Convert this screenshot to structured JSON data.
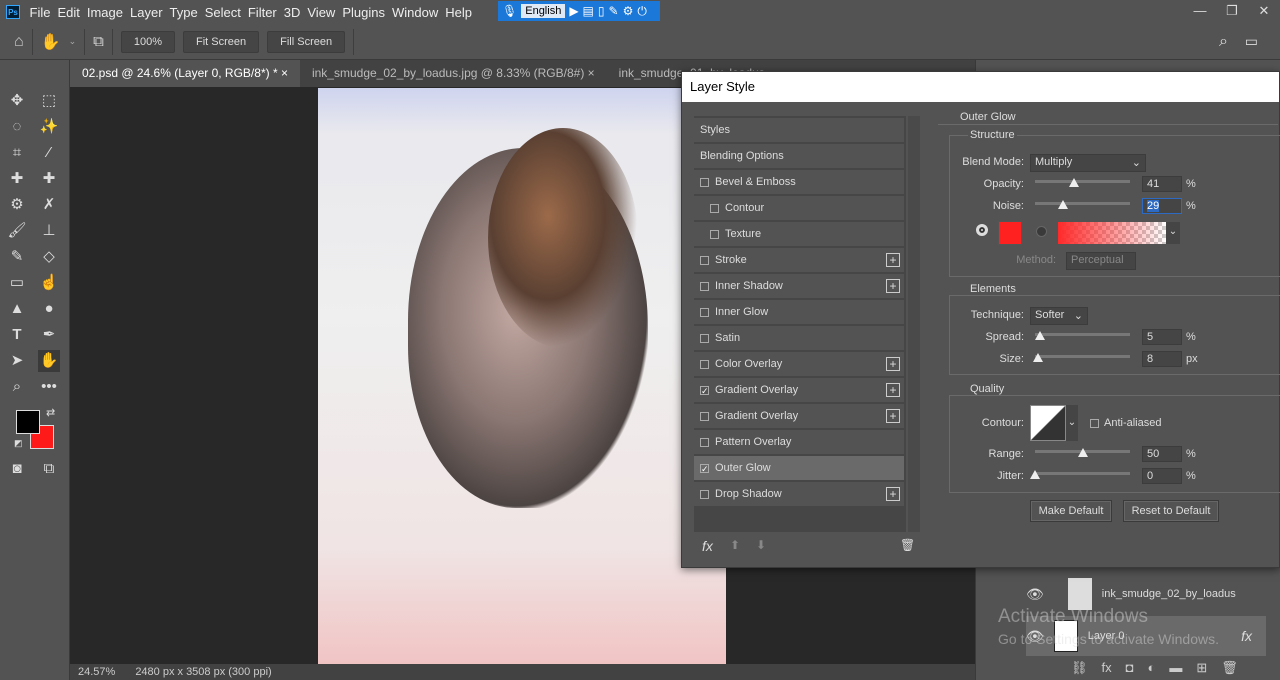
{
  "app": {
    "logo": "Ps",
    "menus": [
      "File",
      "Edit",
      "Image",
      "Layer",
      "Type",
      "Select",
      "Filter",
      "3D",
      "View",
      "Plugins",
      "Window",
      "Help"
    ],
    "ime_language": "English",
    "window_controls": [
      "minimize",
      "restore",
      "close"
    ]
  },
  "options_bar": {
    "zoom_100": "100%",
    "fit_screen": "Fit Screen",
    "fill_screen": "Fill Screen"
  },
  "tabs": [
    {
      "label": "02.psd @ 24.6% (Layer 0, RGB/8*) *",
      "close": "×"
    },
    {
      "label": "ink_smudge_02_by_loadus.jpg @ 8.33% (RGB/8#)",
      "close": "×"
    },
    {
      "label": "ink_smudge_01_by_loadus",
      "close": ""
    }
  ],
  "colors": {
    "foreground": "#000000",
    "background": "#ff1a1a",
    "glow": "#ff2020"
  },
  "status": {
    "zoom": "24.57%",
    "doc_info": "2480 px x 3508 px (300 ppi)"
  },
  "layers": [
    {
      "name": "ink_smudge_02_by_loadus"
    },
    {
      "name": "Layer 0",
      "fx": "fx"
    }
  ],
  "watermark": {
    "line1": "Activate Windows",
    "line2": "Go to Settings to activate Windows."
  },
  "dialog": {
    "title": "Layer Style",
    "styles": [
      {
        "label": "Styles",
        "checkbox": false,
        "plus": false,
        "indent": false
      },
      {
        "label": "Blending Options",
        "checkbox": false,
        "plus": false,
        "indent": false
      },
      {
        "label": "Bevel & Emboss",
        "checkbox": true,
        "checked": false,
        "plus": false,
        "indent": false
      },
      {
        "label": "Contour",
        "checkbox": true,
        "checked": false,
        "plus": false,
        "indent": true
      },
      {
        "label": "Texture",
        "checkbox": true,
        "checked": false,
        "plus": false,
        "indent": true
      },
      {
        "label": "Stroke",
        "checkbox": true,
        "checked": false,
        "plus": true,
        "indent": false
      },
      {
        "label": "Inner Shadow",
        "checkbox": true,
        "checked": false,
        "plus": true,
        "indent": false
      },
      {
        "label": "Inner Glow",
        "checkbox": true,
        "checked": false,
        "plus": false,
        "indent": false
      },
      {
        "label": "Satin",
        "checkbox": true,
        "checked": false,
        "plus": false,
        "indent": false
      },
      {
        "label": "Color Overlay",
        "checkbox": true,
        "checked": false,
        "plus": true,
        "indent": false
      },
      {
        "label": "Gradient Overlay",
        "checkbox": true,
        "checked": true,
        "plus": true,
        "indent": false
      },
      {
        "label": "Gradient Overlay",
        "checkbox": true,
        "checked": false,
        "plus": true,
        "indent": false
      },
      {
        "label": "Pattern Overlay",
        "checkbox": true,
        "checked": false,
        "plus": false,
        "indent": false
      },
      {
        "label": "Outer Glow",
        "checkbox": true,
        "checked": true,
        "plus": false,
        "indent": false,
        "selected": true
      },
      {
        "label": "Drop Shadow",
        "checkbox": true,
        "checked": false,
        "plus": true,
        "indent": false
      }
    ],
    "fx_label": "fx",
    "section": "Outer Glow",
    "structure": {
      "title": "Structure",
      "blend_mode_label": "Blend Mode:",
      "blend_mode": "Multiply",
      "opacity_label": "Opacity:",
      "opacity": "41",
      "noise_label": "Noise:",
      "noise": "29",
      "unit": "%",
      "method_label": "Method:",
      "method": "Perceptual"
    },
    "elements": {
      "title": "Elements",
      "technique_label": "Technique:",
      "technique": "Softer",
      "spread_label": "Spread:",
      "spread": "5",
      "spread_unit": "%",
      "size_label": "Size:",
      "size": "8",
      "size_unit": "px"
    },
    "quality": {
      "title": "Quality",
      "contour_label": "Contour:",
      "anti_aliased": "Anti-aliased",
      "range_label": "Range:",
      "range": "50",
      "jitter_label": "Jitter:",
      "jitter": "0",
      "unit": "%"
    },
    "make_default": "Make Default",
    "reset_default": "Reset to Default"
  }
}
